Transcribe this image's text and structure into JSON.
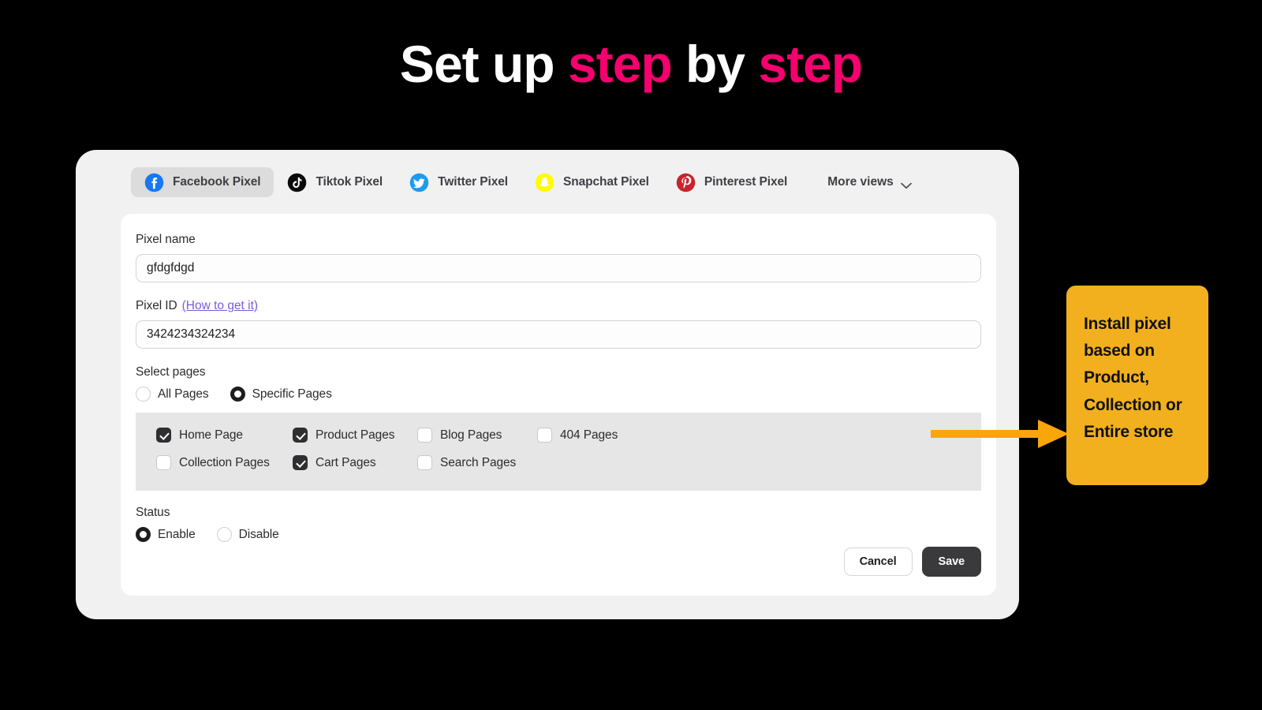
{
  "headline": {
    "part1": "Set up ",
    "part2": "step",
    "part3": " by ",
    "part4": "step",
    "pink_color": "#F5006E"
  },
  "tabs": [
    {
      "label": "Facebook Pixel",
      "icon": "facebook-icon",
      "active": true
    },
    {
      "label": "Tiktok Pixel",
      "icon": "tiktok-icon",
      "active": false
    },
    {
      "label": "Twitter Pixel",
      "icon": "twitter-icon",
      "active": false
    },
    {
      "label": "Snapchat Pixel",
      "icon": "snapchat-icon",
      "active": false
    },
    {
      "label": "Pinterest Pixel",
      "icon": "pinterest-icon",
      "active": false
    }
  ],
  "more_views": {
    "label": "More views",
    "icon": "chevron-down-icon"
  },
  "form": {
    "pixel_name": {
      "label": "Pixel name",
      "value": "gfdgfdgd",
      "placeholder": "Pixel name"
    },
    "pixel_id": {
      "label": "Pixel ID",
      "help_link": "(How to get it)",
      "value": "3424234324234",
      "placeholder": "Pixel ID"
    },
    "select_pages": {
      "label": "Select pages",
      "options": [
        {
          "label": "All Pages",
          "selected": false
        },
        {
          "label": "Specific Pages",
          "selected": true
        }
      ],
      "pages": [
        {
          "label": "Home Page",
          "checked": true
        },
        {
          "label": "Product Pages",
          "checked": true
        },
        {
          "label": "Blog Pages",
          "checked": false
        },
        {
          "label": "404 Pages",
          "checked": false
        },
        {
          "label": "Collection Pages",
          "checked": false
        },
        {
          "label": "Cart Pages",
          "checked": true
        },
        {
          "label": "Search Pages",
          "checked": false
        }
      ]
    },
    "status": {
      "label": "Status",
      "options": [
        {
          "label": "Enable",
          "selected": true
        },
        {
          "label": "Disable",
          "selected": false
        }
      ]
    }
  },
  "actions": {
    "cancel_label": "Cancel",
    "save_label": "Save"
  },
  "callout": {
    "text": "Install pixel based on Product, Collection or Entire store",
    "background_color": "#F2B01E",
    "arrow_color": "#F9A60A",
    "arrow_icon": "arrow-right-icon"
  }
}
